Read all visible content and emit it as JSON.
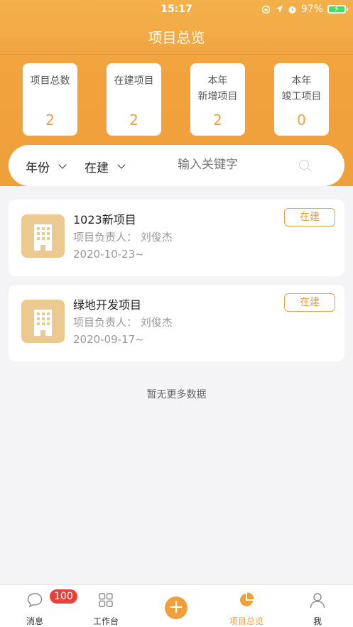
{
  "status_bar": {
    "time": "15:17",
    "battery": "97%"
  },
  "nav": {
    "title": "项目总览"
  },
  "stats": [
    {
      "label": "项目总数",
      "value": "2"
    },
    {
      "label": "在建项目",
      "value": "2"
    },
    {
      "label": "本年\n新增项目",
      "value": "2"
    },
    {
      "label": "本年\n竣工项目",
      "value": "0"
    }
  ],
  "filters": {
    "year": "年份",
    "status": "在建",
    "search_placeholder": "输入关键字"
  },
  "projects": [
    {
      "name": "1023新项目",
      "manager": "项目负责人：  刘俊杰",
      "date": "2020-10-23~",
      "status": "在建"
    },
    {
      "name": "绿地开发项目",
      "manager": "项目负责人：  刘俊杰",
      "date": "2020-09-17~",
      "status": "在建"
    }
  ],
  "empty_hint": "暂无更多数据",
  "tabbar": {
    "items": [
      {
        "label": "消息",
        "icon": "chat-bubble-icon",
        "badge": "100"
      },
      {
        "label": "工作台",
        "icon": "grid-icon"
      },
      {
        "label": "",
        "icon": "plus-icon"
      },
      {
        "label": "项目总览",
        "icon": "pie-chart-icon"
      },
      {
        "label": "我",
        "icon": "user-icon"
      }
    ]
  },
  "colors": {
    "accent": "#f0a03a",
    "badge_red": "#e8403a"
  }
}
